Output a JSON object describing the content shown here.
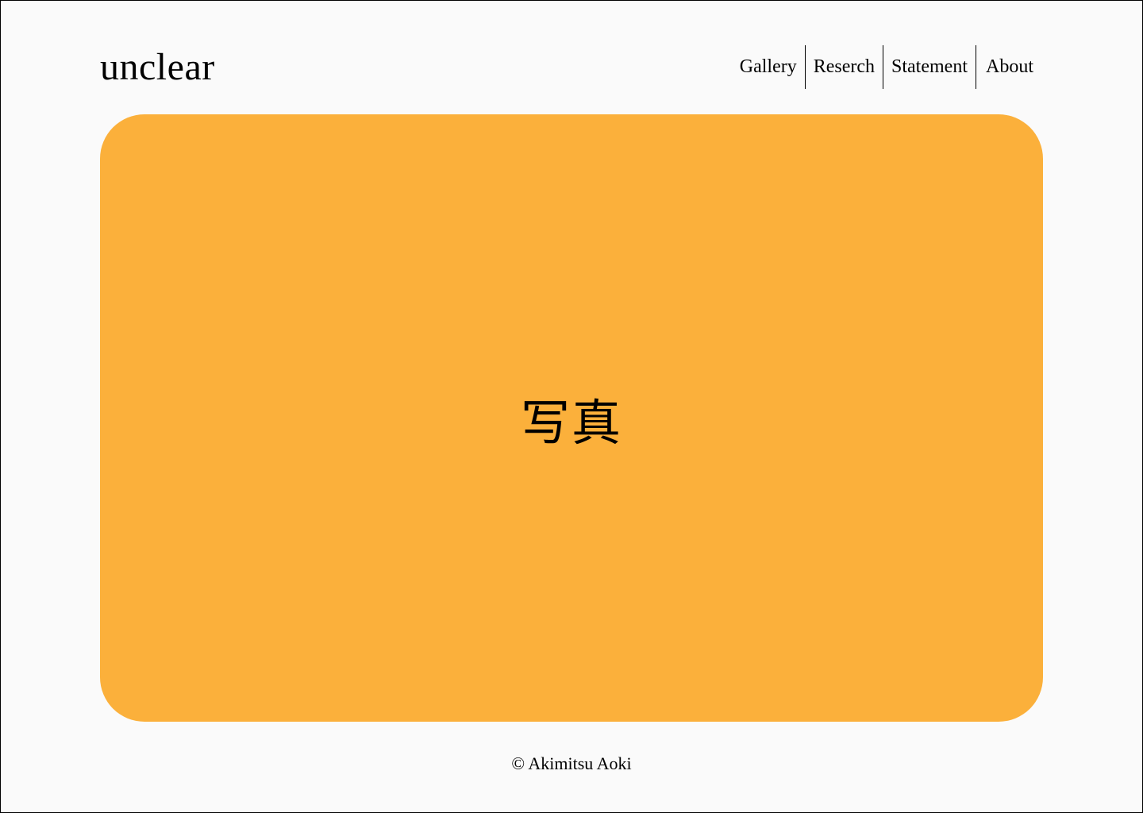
{
  "header": {
    "logo": "unclear",
    "nav": [
      {
        "label": "Gallery"
      },
      {
        "label": "Reserch"
      },
      {
        "label": "Statement"
      },
      {
        "label": "About"
      }
    ]
  },
  "hero": {
    "label": "写真",
    "color": "#fbb03b"
  },
  "footer": {
    "copyright": "© Akimitsu Aoki"
  }
}
